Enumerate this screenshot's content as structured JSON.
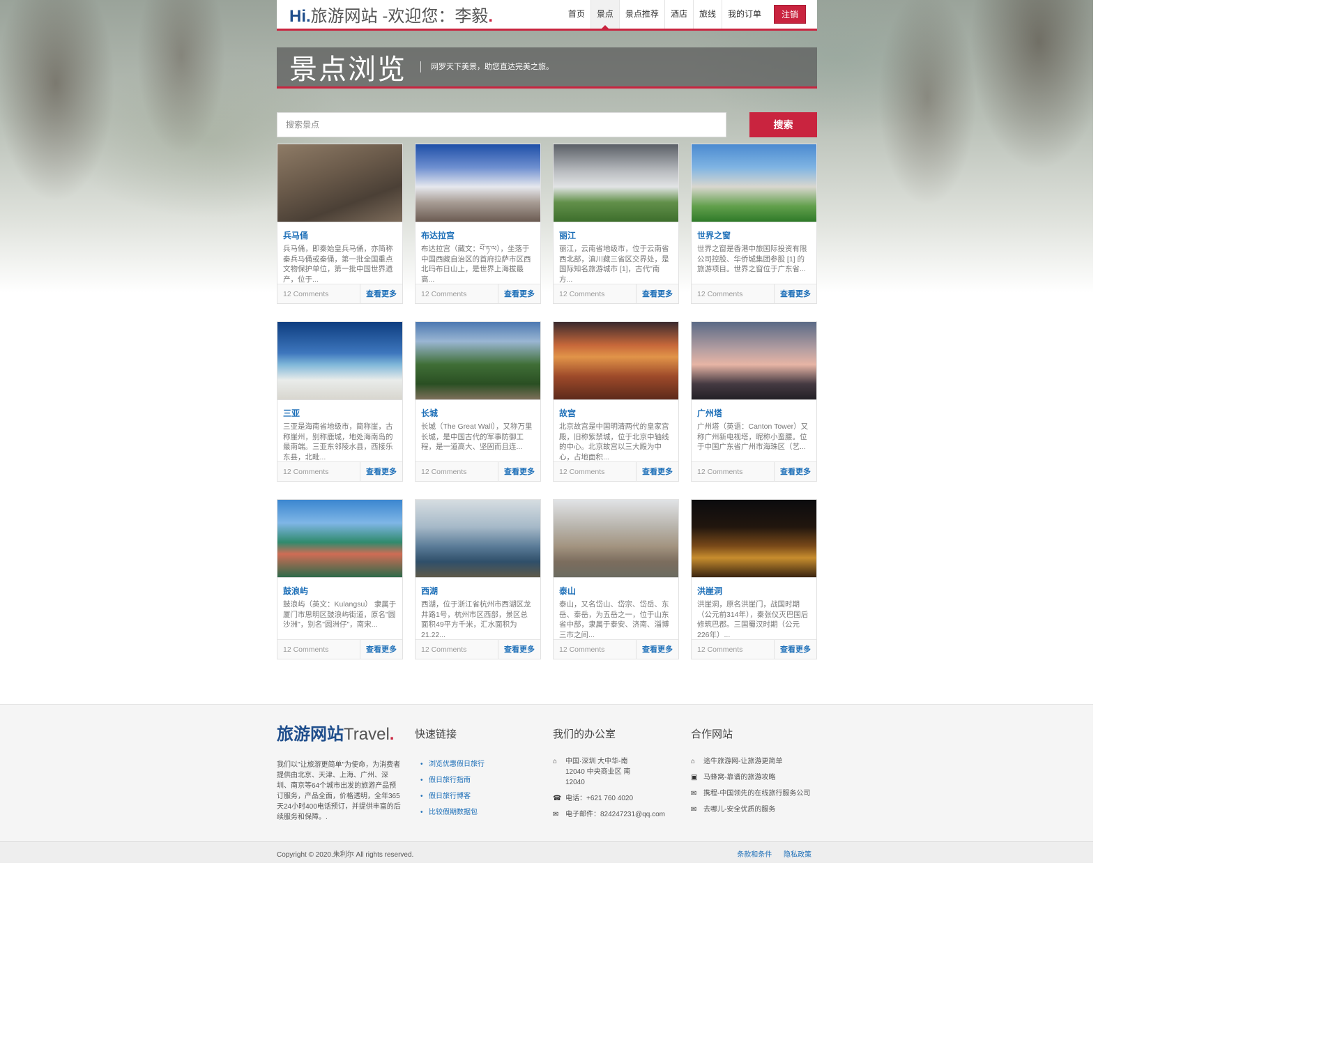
{
  "header": {
    "brand_hi": "Hi.",
    "brand_text": "旅游网站 -欢迎您：李毅",
    "brand_dot": ".",
    "nav": [
      {
        "label": "首页",
        "active": false
      },
      {
        "label": "景点",
        "active": true
      },
      {
        "label": "景点推荐",
        "active": false
      },
      {
        "label": "酒店",
        "active": false
      },
      {
        "label": "旅线",
        "active": false
      },
      {
        "label": "我的订单",
        "active": false
      }
    ],
    "logout_label": "注销"
  },
  "page": {
    "title": "景点浏览",
    "subtitle": "网罗天下美景，助您直达完美之旅。"
  },
  "search": {
    "placeholder": "搜索景点",
    "button_label": "搜索"
  },
  "cards": [
    {
      "title": "兵马俑",
      "desc": "兵马俑，即秦始皇兵马俑，亦简称秦兵马俑或秦俑，第一批全国重点文物保护单位，第一批中国世界遗产，位于...",
      "comments": "12 Comments",
      "more": "查看更多",
      "image": "terracotta-warriors-photo"
    },
    {
      "title": "布达拉宫",
      "desc": "布达拉宫（藏文：པོ་ཏ་ལ），坐落于中国西藏自治区的首府拉萨市区西北玛布日山上，是世界上海拔最高...",
      "comments": "12 Comments",
      "more": "查看更多",
      "image": "potala-palace-photo"
    },
    {
      "title": "丽江",
      "desc": "丽江，云南省地级市，位于云南省西北部，滇川藏三省区交界处，是国际知名旅游城市 [1]，古代\"南方...",
      "comments": "12 Comments",
      "more": "查看更多",
      "image": "lijiang-photo"
    },
    {
      "title": "世界之窗",
      "desc": "世界之窗是香港中旅国际投资有限公司控股、华侨城集团参股 [1] 的旅游项目。世界之窗位于广东省...",
      "comments": "12 Comments",
      "more": "查看更多",
      "image": "window-of-the-world-photo"
    },
    {
      "title": "三亚",
      "desc": "三亚是海南省地级市，简称崖，古称崖州，别称鹿城，地处海南岛的最南端。三亚东邻陵水县，西接乐东县，北毗...",
      "comments": "12 Comments",
      "more": "查看更多",
      "image": "sanya-beach-photo"
    },
    {
      "title": "长城",
      "desc": "长城（The Great Wall），又称万里长城，是中国古代的军事防御工程，是一道高大、坚固而且连...",
      "comments": "12 Comments",
      "more": "查看更多",
      "image": "great-wall-photo"
    },
    {
      "title": "故宫",
      "desc": "北京故宫是中国明清两代的皇家宫殿，旧称紫禁城，位于北京中轴线的中心。北京故宫以三大殿为中心，占地面积...",
      "comments": "12 Comments",
      "more": "查看更多",
      "image": "forbidden-city-photo"
    },
    {
      "title": "广州塔",
      "desc": "广州塔（英语：Canton Tower）又称广州新电视塔，昵称小蛮腰。位于中国广东省广州市海珠区（艺...",
      "comments": "12 Comments",
      "more": "查看更多",
      "image": "canton-tower-photo"
    },
    {
      "title": "鼓浪屿",
      "desc": "鼓浪屿（英文：Kulangsu） 隶属于厦门市思明区鼓浪屿街道，原名\"圆沙洲\"，别名\"圆洲仔\"，南宋...",
      "comments": "12 Comments",
      "more": "查看更多",
      "image": "gulangyu-photo"
    },
    {
      "title": "西湖",
      "desc": "西湖，位于浙江省杭州市西湖区龙井路1号，杭州市区西部，景区总面积49平方千米，汇水面积为21.22...",
      "comments": "12 Comments",
      "more": "查看更多",
      "image": "west-lake-photo"
    },
    {
      "title": "泰山",
      "desc": "泰山，又名岱山、岱宗、岱岳、东岳、泰岳，为五岳之一，位于山东省中部，隶属于泰安、济南、淄博三市之间...",
      "comments": "12 Comments",
      "more": "查看更多",
      "image": "mount-tai-photo"
    },
    {
      "title": "洪崖洞",
      "desc": "洪崖洞，原名洪崖门，战国时期（公元前314年），秦张仪灭巴国后修筑巴郡。三国蜀汉时期（公元226年）...",
      "comments": "12 Comments",
      "more": "查看更多",
      "image": "hongyadong-photo"
    }
  ],
  "footer": {
    "logo_main": "旅游网站",
    "logo_sub": "Travel",
    "logo_dot": ".",
    "about": "我们以\"让旅游更简单\"为使命，为消费者提供由北京、天津、上海、广州、深圳、南京等64个城市出发的旅游产品预订服务，产品全面，价格透明，全年365天24小时400电话预订，并提供丰富的后续服务和保障。.",
    "quick_links_title": "快速链接",
    "quick_links": [
      "浏览优惠假日旅行",
      "假日旅行指南",
      "假日旅行博客",
      "比较假期数据包"
    ],
    "office_title": "我们的办公室",
    "office": [
      {
        "icon": "home-icon",
        "glyph": "⌂",
        "text": "中国·深圳 大中华-南12040 中央商业区 南12040"
      },
      {
        "icon": "phone-icon",
        "glyph": "☎",
        "text": "电话：+621 760 4020"
      },
      {
        "icon": "mail-icon",
        "glyph": "✉",
        "text": "电子邮件：824247231@qq.com"
      }
    ],
    "partners_title": "合作网站",
    "partners": [
      {
        "icon": "home-icon",
        "glyph": "⌂",
        "text": "途牛旅游网-让旅游更简单"
      },
      {
        "icon": "briefcase-icon",
        "glyph": "▣",
        "text": "马蜂窝-靠谱的旅游攻略"
      },
      {
        "icon": "mail-icon",
        "glyph": "✉",
        "text": "携程-中国领先的在线旅行服务公司"
      },
      {
        "icon": "mail-icon",
        "glyph": "✉",
        "text": "去哪儿-安全优质的服务"
      }
    ]
  },
  "bottom": {
    "copyright": "Copyright © 2020.朱利尔 All rights reserved.",
    "terms": "条款和条件",
    "privacy": "隐私政策"
  },
  "colors": {
    "accent": "#c9243f",
    "brand": "#1f4e8c",
    "link": "#1d6fb8"
  }
}
